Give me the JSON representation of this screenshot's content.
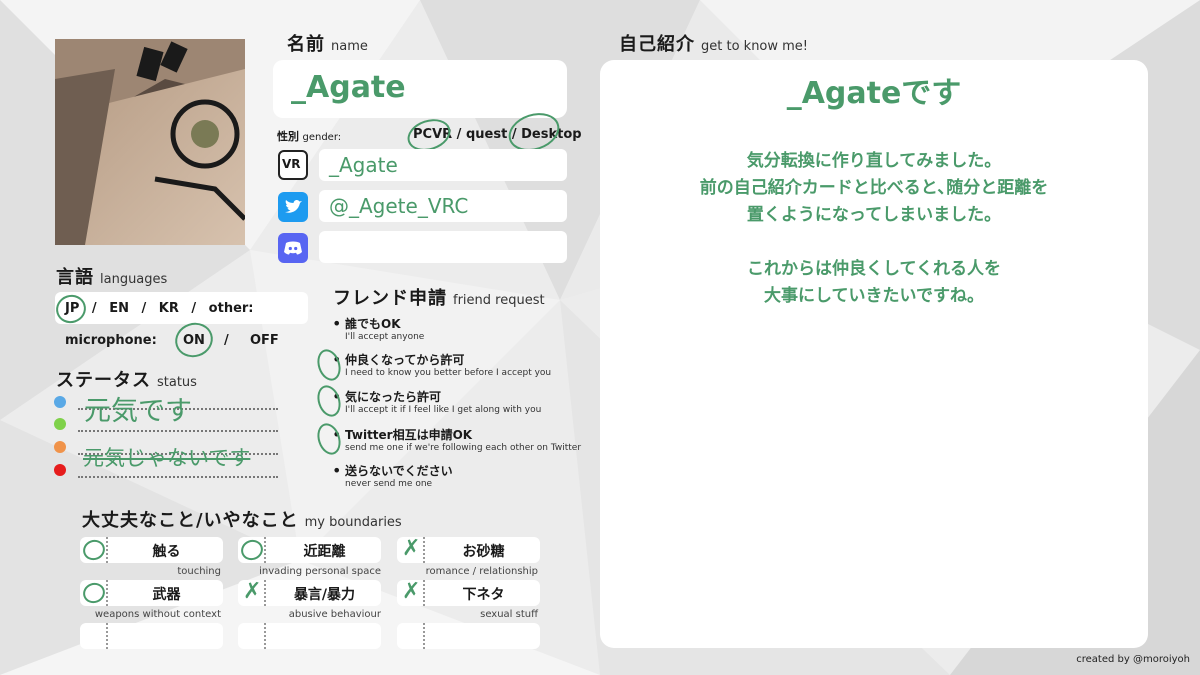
{
  "name_section": {
    "title_jp": "名前",
    "title_en": "name",
    "name_value": "_Agate"
  },
  "gender": {
    "label_jp": "性別",
    "label_en": "gender:",
    "options": [
      "PCVR",
      "/",
      "quest",
      "/",
      "Desktop"
    ]
  },
  "social": {
    "vr_label": "VR",
    "vr_value": "_Agate",
    "twitter_value": "@_Agete_VRC",
    "discord_value": ""
  },
  "languages": {
    "title_jp": "言語",
    "title_en": "languages",
    "options": [
      "JP",
      "/",
      "EN",
      "/",
      "KR",
      "/",
      "other:"
    ],
    "mic_label": "microphone:",
    "mic_on": "ON",
    "mic_sep": "/",
    "mic_off": "OFF"
  },
  "status": {
    "title_jp": "ステータス",
    "title_en": "status",
    "fine_text": "元気です",
    "not_fine_text": "元気じゃないです",
    "dot_colors": [
      "#5aa9e6",
      "#7fd14a",
      "#f0934a",
      "#e61c1c"
    ]
  },
  "friend_request": {
    "title_jp": "フレンド申請",
    "title_en": "friend request",
    "items": [
      {
        "jp": "誰でもOK",
        "en": "I'll accept anyone"
      },
      {
        "jp": "仲良くなってから許可",
        "en": "I need to know you better before I accept you"
      },
      {
        "jp": "気になったら許可",
        "en": "I'll accept it if I feel like I get along with you"
      },
      {
        "jp": "Twitter相互は申請OK",
        "en": "send me one if we're following each other on Twitter"
      },
      {
        "jp": "送らないでください",
        "en": "never send me one"
      }
    ]
  },
  "boundaries": {
    "title_jp": "大丈夫なこと/いやなこと",
    "title_en": "my boundaries",
    "items": [
      {
        "jp": "触る",
        "en": "touching",
        "mark": "o"
      },
      {
        "jp": "近距離",
        "en": "invading personal space",
        "mark": "o"
      },
      {
        "jp": "お砂糖",
        "en": "romance / relationship",
        "mark": "x"
      },
      {
        "jp": "武器",
        "en": "weapons without context",
        "mark": "o"
      },
      {
        "jp": "暴言/暴力",
        "en": "abusive behaviour",
        "mark": "x"
      },
      {
        "jp": "下ネタ",
        "en": "sexual stuff",
        "mark": "x"
      },
      {
        "jp": "",
        "en": "",
        "mark": ""
      },
      {
        "jp": "",
        "en": "",
        "mark": ""
      },
      {
        "jp": "",
        "en": "",
        "mark": ""
      }
    ]
  },
  "intro": {
    "title_jp": "自己紹介",
    "title_en": "get to know me!",
    "heading": "_Agateです",
    "line1": "気分転換に作り直してみました。",
    "line2": "前の自己紹介カードと比べると､随分と距離を",
    "line3": "置くようになってしまいました。",
    "line4": "これからは仲良くしてくれる人を",
    "line5": "大事にしていきたいですね。"
  },
  "credit": "created by @moroiyoh",
  "colors": {
    "accent_green": "#4a9a6a",
    "twitter_blue": "#1d9bf0",
    "discord_purple": "#5865f2"
  }
}
